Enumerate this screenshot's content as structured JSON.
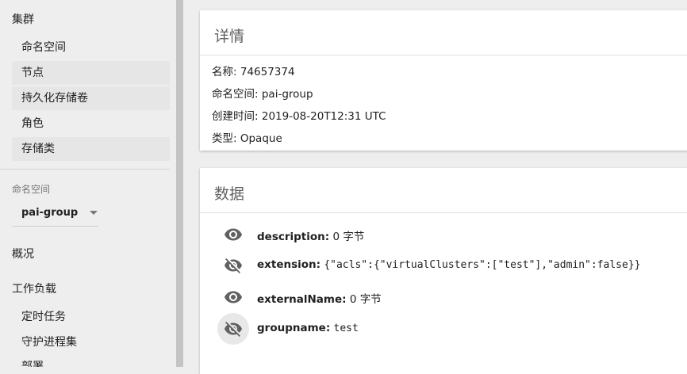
{
  "sidebar": {
    "cluster_heading": "集群",
    "cluster_items": [
      {
        "label": "命名空间"
      },
      {
        "label": "节点"
      },
      {
        "label": "持久化存储卷"
      },
      {
        "label": "角色"
      },
      {
        "label": "存储类"
      }
    ],
    "namespace_label": "命名空间",
    "namespace_value": "pai-group",
    "overview": "概况",
    "workloads_heading": "工作负载",
    "workload_items": [
      {
        "label": "定时任务"
      },
      {
        "label": "守护进程集"
      },
      {
        "label": "部署"
      }
    ]
  },
  "details": {
    "title": "详情",
    "name_label": "名称:",
    "name_value": "74657374",
    "namespace_label": "命名空间:",
    "namespace_value": "pai-group",
    "created_label": "创建时间:",
    "created_value": "2019-08-20T12:31 UTC",
    "type_label": "类型:",
    "type_value": "Opaque"
  },
  "data": {
    "title": "数据",
    "rows": [
      {
        "key": "description:",
        "value": "0 字节",
        "icon": "eye-icon",
        "mono": false
      },
      {
        "key": "extension:",
        "value": "{\"acls\":{\"virtualClusters\":[\"test\"],\"admin\":false}}",
        "icon": "eye-off-icon",
        "mono": true
      },
      {
        "key": "externalName:",
        "value": "0 字节",
        "icon": "eye-icon",
        "mono": false
      },
      {
        "key": "groupname:",
        "value": "test",
        "icon": "eye-off-icon",
        "mono": true
      }
    ]
  },
  "colors": {
    "icon": "#616161",
    "sidebar_bg": "#eeeeee",
    "divider": "#c4c4c4"
  }
}
